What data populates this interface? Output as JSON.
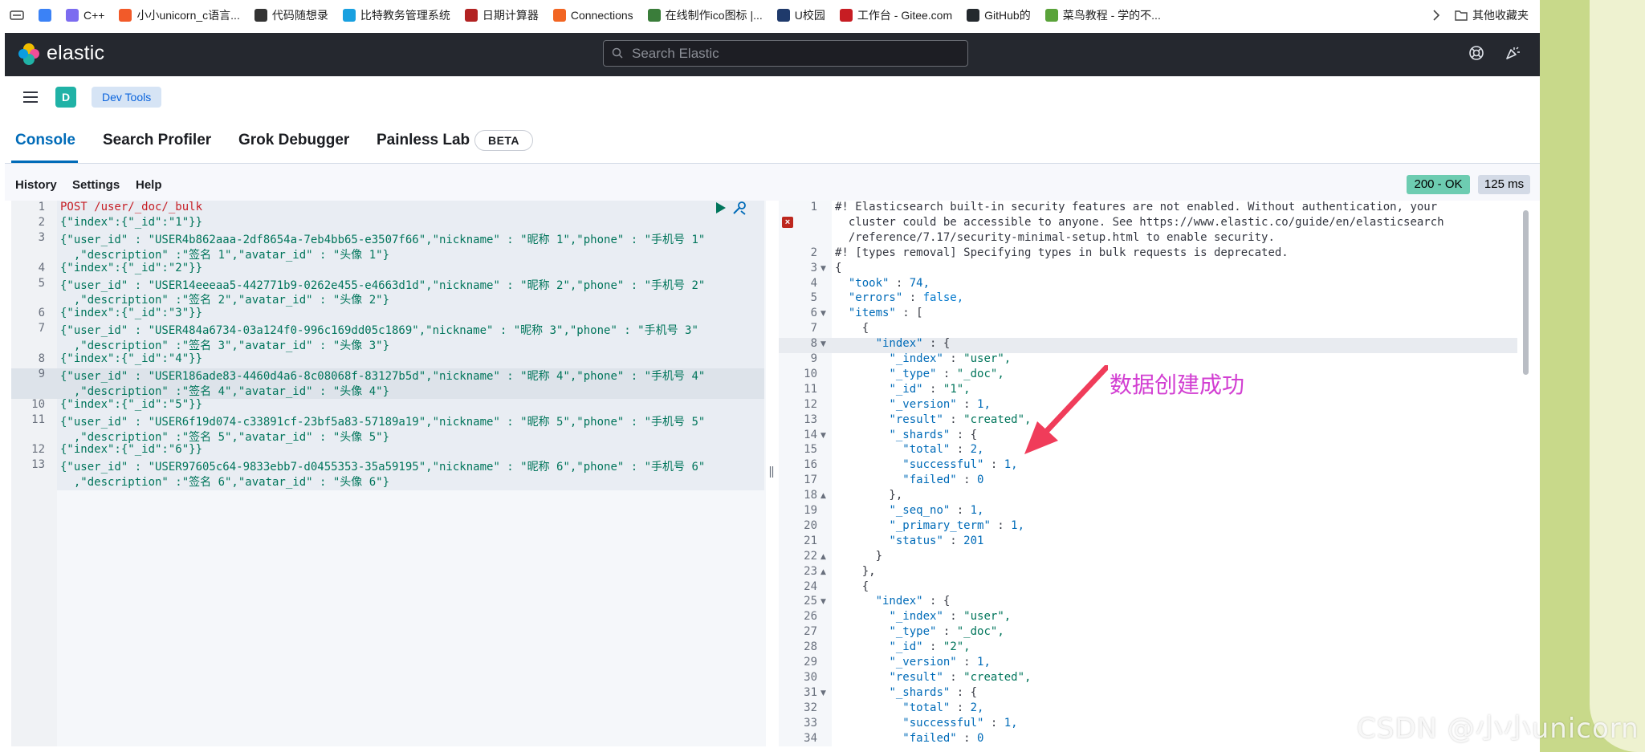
{
  "bookmarks": [
    {
      "label": "",
      "color": "#3b82f6"
    },
    {
      "label": "C++",
      "color": "#7c6cf0"
    },
    {
      "label": "小小unicorn_c语言...",
      "color": "#f25a29"
    },
    {
      "label": "代码随想录",
      "color": "#333333"
    },
    {
      "label": "比特教务管理系统",
      "color": "#18a0e0"
    },
    {
      "label": "日期计算器",
      "color": "#b22222"
    },
    {
      "label": "Connections",
      "color": "#f26522"
    },
    {
      "label": "在线制作ico图标 |...",
      "color": "#3a7d3a"
    },
    {
      "label": "U校园",
      "color": "#1f3a6b"
    },
    {
      "label": "工作台 - Gitee.com",
      "color": "#c71d23"
    },
    {
      "label": "GitHub的",
      "color": "#24292e"
    },
    {
      "label": "菜鸟教程 - 学的不...",
      "color": "#5aa33a"
    }
  ],
  "bookmarks_more": "其他收藏夹",
  "header": {
    "brand": "elastic",
    "search_placeholder": "Search Elastic"
  },
  "breadcrumb": {
    "avatar_letter": "D",
    "current": "Dev Tools"
  },
  "tabs": [
    "Console",
    "Search Profiler",
    "Grok Debugger",
    "Painless Lab"
  ],
  "beta_label": "BETA",
  "toolbar": {
    "history": "History",
    "settings": "Settings",
    "help": "Help",
    "status": "200 - OK",
    "time": "125 ms"
  },
  "request": {
    "line_numbers": [
      "1",
      "2",
      "3",
      "",
      "4",
      "5",
      "",
      "6",
      "7",
      "",
      "8",
      "9",
      "",
      "10",
      "11",
      "",
      "12",
      "13",
      ""
    ],
    "lines": [
      "POST /user/_doc/_bulk",
      "{\"index\":{\"_id\":\"1\"}}",
      "{\"user_id\" : \"USER4b862aaa-2df8654a-7eb4bb65-e3507f66\",\"nickname\" : \"昵称 1\",\"phone\" : \"手机号 1\"",
      "  ,\"description\" :\"签名 1\",\"avatar_id\" : \"头像 1\"}",
      "{\"index\":{\"_id\":\"2\"}}",
      "{\"user_id\" : \"USER14eeeaa5-442771b9-0262e455-e4663d1d\",\"nickname\" : \"昵称 2\",\"phone\" : \"手机号 2\"",
      "  ,\"description\" :\"签名 2\",\"avatar_id\" : \"头像 2\"}",
      "{\"index\":{\"_id\":\"3\"}}",
      "{\"user_id\" : \"USER484a6734-03a124f0-996c169dd05c1869\",\"nickname\" : \"昵称 3\",\"phone\" : \"手机号 3\"",
      "  ,\"description\" :\"签名 3\",\"avatar_id\" : \"头像 3\"}",
      "{\"index\":{\"_id\":\"4\"}}",
      "{\"user_id\" : \"USER186ade83-4460d4a6-8c08068f-83127b5d\",\"nickname\" : \"昵称 4\",\"phone\" : \"手机号 4\"",
      "  ,\"description\" :\"签名 4\",\"avatar_id\" : \"头像 4\"}",
      "{\"index\":{\"_id\":\"5\"}}",
      "{\"user_id\" : \"USER6f19d074-c33891cf-23bf5a83-57189a19\",\"nickname\" : \"昵称 5\",\"phone\" : \"手机号 5\"",
      "  ,\"description\" :\"签名 5\",\"avatar_id\" : \"头像 5\"}",
      "{\"index\":{\"_id\":\"6\"}}",
      "{\"user_id\" : \"USER97605c64-9833ebb7-d0455353-35a59195\",\"nickname\" : \"昵称 6\",\"phone\" : \"手机号 6\"",
      "  ,\"description\" :\"签名 6\",\"avatar_id\" : \"头像 6\"}"
    ]
  },
  "response": {
    "line_numbers": [
      "1",
      "",
      "",
      "2",
      "3",
      "4",
      "5",
      "6",
      "7",
      "8",
      "9",
      "10",
      "11",
      "12",
      "13",
      "14",
      "15",
      "16",
      "17",
      "18",
      "19",
      "20",
      "21",
      "22",
      "23",
      "24",
      "25",
      "26",
      "27",
      "28",
      "29",
      "30",
      "31",
      "32",
      "33",
      "34"
    ],
    "lines": [
      "#! Elasticsearch built-in security features are not enabled. Without authentication, your",
      "  cluster could be accessible to anyone. See https://www.elastic.co/guide/en/elasticsearch",
      "  /reference/7.17/security-minimal-setup.html to enable security.",
      "#! [types removal] Specifying types in bulk requests is deprecated.",
      "{",
      "  \"took\" : 74,",
      "  \"errors\" : false,",
      "  \"items\" : [",
      "    {",
      "      \"index\" : {",
      "        \"_index\" : \"user\",",
      "        \"_type\" : \"_doc\",",
      "        \"_id\" : \"1\",",
      "        \"_version\" : 1,",
      "        \"result\" : \"created\",",
      "        \"_shards\" : {",
      "          \"total\" : 2,",
      "          \"successful\" : 1,",
      "          \"failed\" : 0",
      "        },",
      "        \"_seq_no\" : 1,",
      "        \"_primary_term\" : 1,",
      "        \"status\" : 201",
      "      }",
      "    },",
      "    {",
      "      \"index\" : {",
      "        \"_index\" : \"user\",",
      "        \"_type\" : \"_doc\",",
      "        \"_id\" : \"2\",",
      "        \"_version\" : 1,",
      "        \"result\" : \"created\",",
      "        \"_shards\" : {",
      "          \"total\" : 2,",
      "          \"successful\" : 1,",
      "          \"failed\" : 0"
    ]
  },
  "annotation": "数据创建成功",
  "watermark": "CSDN @小小unicorn",
  "colors": {
    "accent": "#006bb8",
    "status_ok": "#6dccb1",
    "annotation": "#d23fd2",
    "string": "#00755b",
    "method": "#c61e25"
  }
}
